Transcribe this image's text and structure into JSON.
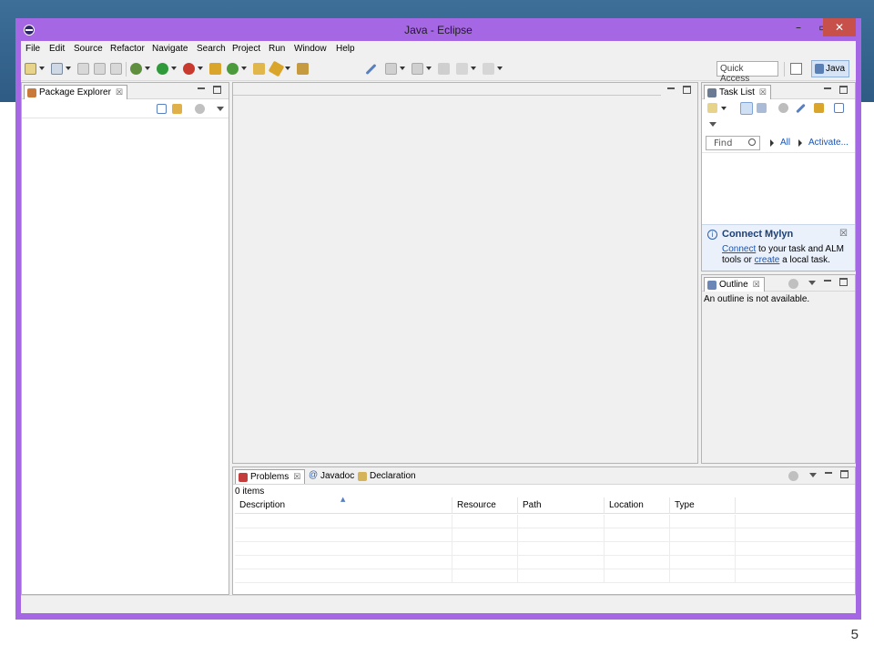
{
  "slide": {
    "number": "5"
  },
  "window": {
    "title": "Java - Eclipse",
    "min": "–",
    "max": "▭",
    "close": "✕"
  },
  "menu": [
    "File",
    "Edit",
    "Source",
    "Refactor",
    "Navigate",
    "Search",
    "Project",
    "Run",
    "Window",
    "Help"
  ],
  "toolbar": {
    "quick_access": "Quick Access",
    "perspective": "Java"
  },
  "package_explorer": {
    "tab": "Package Explorer",
    "close": "☒"
  },
  "task_list": {
    "tab": "Task List",
    "close": "☒",
    "find_placeholder": "Find",
    "all": "All",
    "activate": "Activate...",
    "mylyn_title": "Connect Mylyn",
    "mylyn_close": "☒",
    "mylyn_line1_link": "Connect",
    "mylyn_line1_rest": " to your task and ALM",
    "mylyn_line2_pre": "tools or ",
    "mylyn_line2_link": "create",
    "mylyn_line2_rest": " a local task."
  },
  "outline": {
    "tab": "Outline",
    "close": "☒",
    "message": "An outline is not available."
  },
  "problems": {
    "tabs": [
      {
        "label": "Problems",
        "close": "☒"
      },
      {
        "label": "Javadoc"
      },
      {
        "label": "Declaration"
      }
    ],
    "count": "0 items",
    "columns": [
      "Description",
      "Resource",
      "Path",
      "Location",
      "Type"
    ]
  },
  "colors": {
    "window_frame": "#a667e4",
    "slide_band": "#2e5b84",
    "close_button": "#c7504a",
    "link": "#1a55b3"
  },
  "icons": [
    "app-icon",
    "new-icon",
    "save-icon",
    "debug-icon",
    "run-icon",
    "search-icon",
    "open-perspective-icon",
    "java-perspective-icon",
    "info-icon",
    "package-icon",
    "task-icon",
    "outline-icon",
    "problems-icon",
    "javadoc-icon",
    "declaration-icon"
  ]
}
